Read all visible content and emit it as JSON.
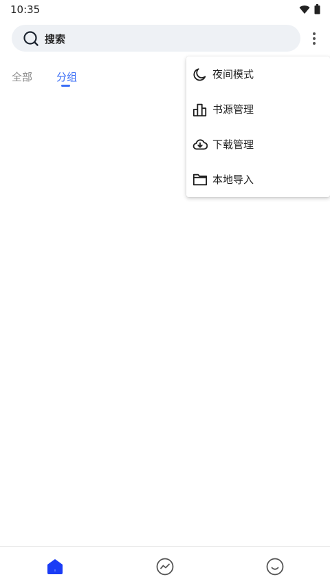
{
  "status_bar": {
    "time": "10:35",
    "icons": [
      "wifi-icon",
      "battery-icon"
    ]
  },
  "search": {
    "label": "搜索",
    "icon": "search-icon"
  },
  "overflow_menu_icon": "more-vertical-icon",
  "tabs": [
    {
      "label": "全部",
      "active": false
    },
    {
      "label": "分组",
      "active": true
    }
  ],
  "menu": {
    "items": [
      {
        "label": "夜间模式",
        "icon": "moon-icon"
      },
      {
        "label": "书源管理",
        "icon": "bar-chart-icon"
      },
      {
        "label": "下载管理",
        "icon": "cloud-download-icon"
      },
      {
        "label": "本地导入",
        "icon": "folder-icon"
      }
    ]
  },
  "bottom_nav": {
    "items": [
      {
        "icon": "home-icon",
        "active": true
      },
      {
        "icon": "trend-icon",
        "active": false
      },
      {
        "icon": "smile-icon",
        "active": false
      }
    ]
  },
  "colors": {
    "accent": "#3b6ef6",
    "active_nav": "#1a3cf5",
    "search_bg": "#eef1f5",
    "inactive_tab": "#888888"
  }
}
